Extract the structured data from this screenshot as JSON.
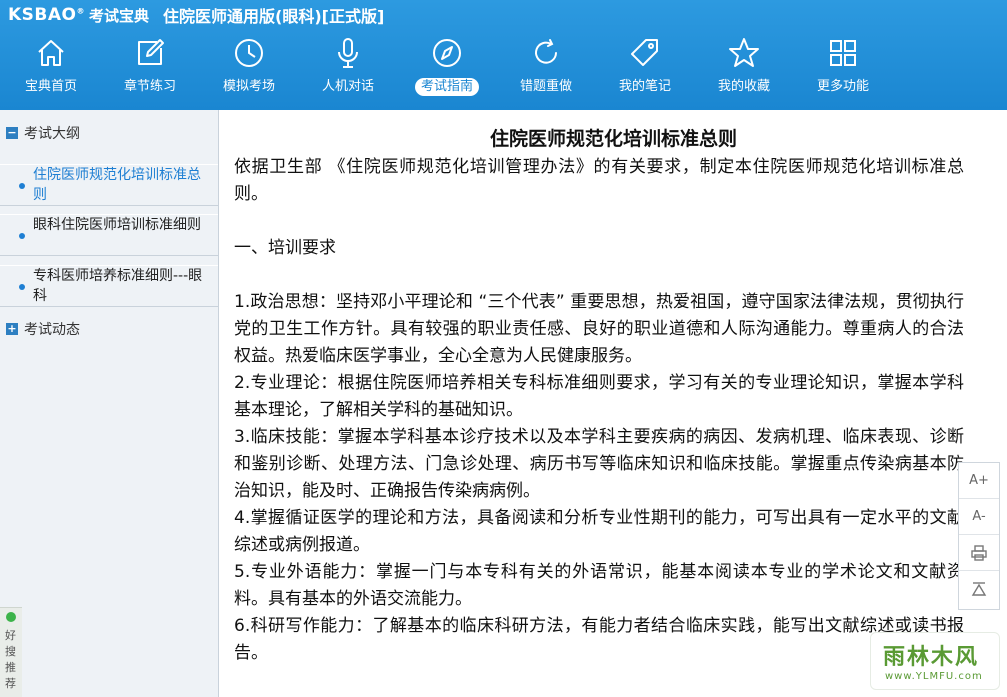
{
  "header": {
    "logo": "KSBAO",
    "logo_cn": "考试宝典",
    "app_title": "住院医师通用版(眼科)[正式版]"
  },
  "nav": [
    {
      "label": "宝典首页",
      "icon": "home-icon"
    },
    {
      "label": "章节练习",
      "icon": "edit-icon"
    },
    {
      "label": "模拟考场",
      "icon": "clock-icon"
    },
    {
      "label": "人机对话",
      "icon": "microphone-icon"
    },
    {
      "label": "考试指南",
      "icon": "compass-icon",
      "active": true
    },
    {
      "label": "错题重做",
      "icon": "refresh-icon"
    },
    {
      "label": "我的笔记",
      "icon": "tag-icon"
    },
    {
      "label": "我的收藏",
      "icon": "star-icon"
    },
    {
      "label": "更多功能",
      "icon": "grid-icon"
    }
  ],
  "sidebar": {
    "section1": {
      "expander": "−",
      "label": "考试大纲"
    },
    "items": [
      {
        "label": "住院医师规范化培训标准总则",
        "active": true
      },
      {
        "label": "眼科住院医师培训标准细则"
      },
      {
        "label": "专科医师培养标准细则---眼科"
      }
    ],
    "section2": {
      "expander": "+",
      "label": "考试动态"
    },
    "haosou": "好搜推荐"
  },
  "document": {
    "title": "住院医师规范化培训标准总则",
    "intro": "依据卫生部 《住院医师规范化培训管理办法》的有关要求，制定本住院医师规范化培训标准总则。",
    "heading1": "一、培训要求",
    "items": [
      "1.政治思想：坚持邓小平理论和 “三个代表” 重要思想，热爱祖国，遵守国家法律法规，贯彻执行党的卫生工作方针。具有较强的职业责任感、良好的职业道德和人际沟通能力。尊重病人的合法权益。热爱临床医学事业，全心全意为人民健康服务。",
      "2.专业理论：根据住院医师培养相关专科标准细则要求，学习有关的专业理论知识，掌握本学科基本理论，了解相关学科的基础知识。",
      "3.临床技能：掌握本学科基本诊疗技术以及本学科主要疾病的病因、发病机理、临床表现、诊断和鉴别诊断、处理方法、门急诊处理、病历书写等临床知识和临床技能。掌握重点传染病基本防治知识，能及时、正确报告传染病病例。",
      "4.掌握循证医学的理论和方法，具备阅读和分析专业性期刊的能力，可写出具有一定水平的文献综述或病例报道。",
      "5.专业外语能力：掌握一门与本专科有关的外语常识，能基本阅读本专业的学术论文和文献资料。具有基本的外语交流能力。",
      "6.科研写作能力：了解基本的临床科研方法，有能力者结合临床实践，能写出文献综述或读书报告。"
    ]
  },
  "tools": {
    "font_up": "A+",
    "font_down": "A-"
  },
  "watermark": {
    "brand": "雨林木风",
    "url": "www.YLMFU.com"
  },
  "colors": {
    "header_blue": "#1a86d1",
    "link_blue": "#1e7fd3",
    "sidebar_bg": "#eef2f6"
  }
}
